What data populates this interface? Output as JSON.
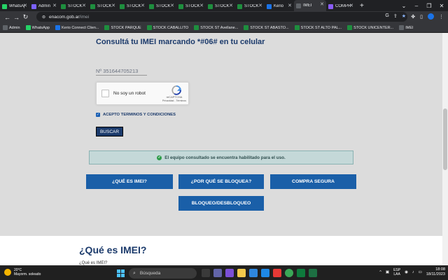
{
  "browser": {
    "tabs": [
      {
        "label": "WhatsApp",
        "color": "#25d366",
        "active": false
      },
      {
        "label": "Admin",
        "color": "#7b61ff",
        "active": false
      },
      {
        "label": "STOCK",
        "color": "#1e8e3e",
        "active": false
      },
      {
        "label": "STOCK",
        "color": "#1e8e3e",
        "active": false
      },
      {
        "label": "STOCK",
        "color": "#1e8e3e",
        "active": false
      },
      {
        "label": "STOCK",
        "color": "#1e8e3e",
        "active": false
      },
      {
        "label": "STOCK",
        "color": "#1e8e3e",
        "active": false
      },
      {
        "label": "STOCK",
        "color": "#1e8e3e",
        "active": false
      },
      {
        "label": "STOCK",
        "color": "#1e8e3e",
        "active": false
      },
      {
        "label": "Kerio",
        "color": "#1a73e8",
        "active": false
      },
      {
        "label": "IMEI",
        "color": "#5f6368",
        "active": true
      },
      {
        "label": "COMPRA",
        "color": "#8a5cf6",
        "active": false
      }
    ],
    "url_domain": "enacom.gob.ar",
    "url_path": "/imei",
    "bookmarks": [
      {
        "label": "Admin",
        "color": "#5f6368"
      },
      {
        "label": "WhatsApp",
        "color": "#25d366"
      },
      {
        "label": "Kerio Connect Clien...",
        "color": "#1a73e8"
      },
      {
        "label": "STOCK PARQUE",
        "color": "#1e8e3e"
      },
      {
        "label": "STOCK CABALLITO",
        "color": "#1e8e3e"
      },
      {
        "label": "STOCK ST Avellane...",
        "color": "#1e8e3e"
      },
      {
        "label": "STOCK ST ABASTO...",
        "color": "#1e8e3e"
      },
      {
        "label": "STOCK ST ALTO PAL...",
        "color": "#1e8e3e"
      },
      {
        "label": "STOCK UNICENTER...",
        "color": "#1e8e3e"
      },
      {
        "label": "IMEI",
        "color": "#5f6368"
      }
    ]
  },
  "page": {
    "heading": "Consultá tu IMEI marcando *#06# en tu celular",
    "imei_value": "Nº 351644705213",
    "captcha": {
      "label": "No soy un robot",
      "brand": "reCAPTCHA",
      "terms": "Privacidad - Términos"
    },
    "terms_label": "ACEPTO TERMINOS Y CONDICIONES",
    "search_button": "BUSCAR",
    "result_message": "El equipo consultado se encuentra habilitado para el uso.",
    "buttons": {
      "que_es_imei": "¿QUÉ ES IMEI?",
      "por_que_bloquea": "¿POR QUÉ SE BLOQUEA?",
      "compra_segura": "COMPRA SEGURA",
      "bloqueo": "BLOQUEO/DESBLOQUEO"
    },
    "section_title": "¿Qué es IMEI?",
    "section_sub": "¿Qué es IMEI?"
  },
  "taskbar": {
    "weather_temp": "20°C",
    "weather_desc": "Mayorm. soleado",
    "search_placeholder": "Búsqueda",
    "lang_top": "ESP",
    "lang_bottom": "LAA",
    "time": "18:08",
    "date": "18/11/2023"
  },
  "colors": {
    "brand_blue": "#1a5fa8",
    "heading_navy": "#1b3a6b",
    "success_bg": "#c4d8d8"
  }
}
